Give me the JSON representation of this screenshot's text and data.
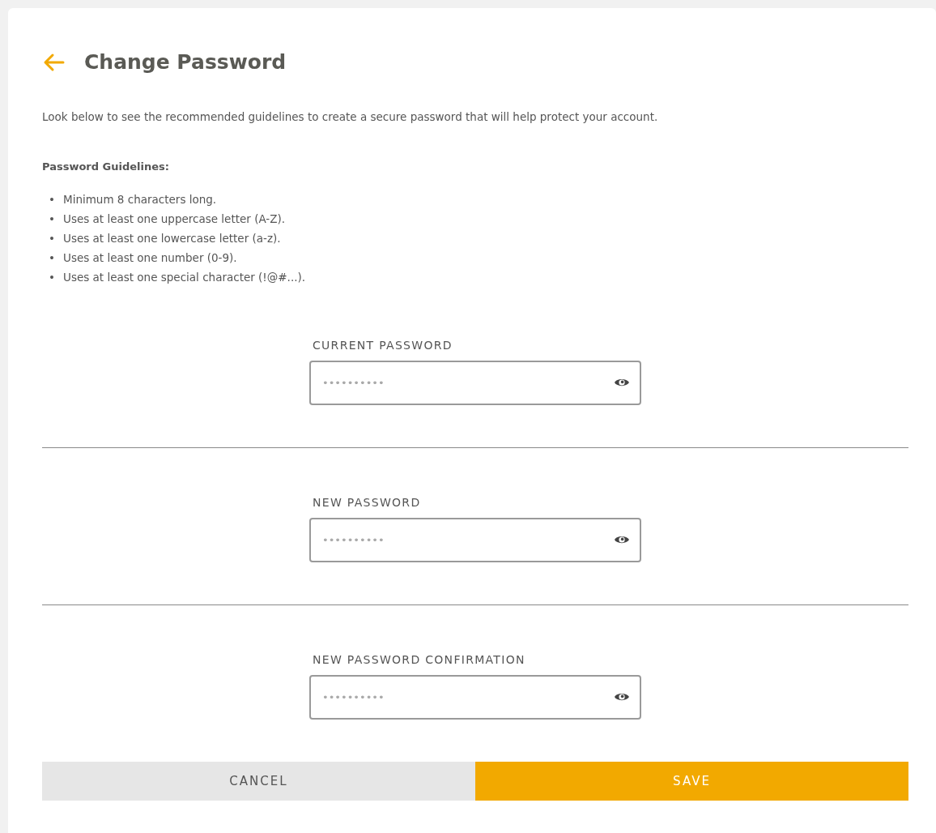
{
  "header": {
    "title": "Change Password"
  },
  "intro": "Look below to see the recommended guidelines to create a secure password that will help protect your account.",
  "guidelines": {
    "heading": "Password Guidelines:",
    "items": [
      {
        "marker": "•",
        "text": "Minimum 8 characters long."
      },
      {
        "marker": "•",
        "text": "Uses at least one uppercase letter (A-Z)."
      },
      {
        "marker": "•",
        "text": "Uses at least one lowercase letter (a-z)."
      },
      {
        "marker": "•",
        "text": "Uses at least one number (0-9)."
      },
      {
        "marker": "•",
        "text": "Uses at least one special character (!@#...)."
      }
    ]
  },
  "fields": [
    {
      "label": "CURRENT PASSWORD",
      "placeholder": "••••••••••"
    },
    {
      "label": "NEW PASSWORD",
      "placeholder": "••••••••••"
    },
    {
      "label": "NEW PASSWORD CONFIRMATION",
      "placeholder": "••••••••••"
    }
  ],
  "buttons": [
    {
      "label": "CANCEL",
      "kind": "secondary"
    },
    {
      "label": "SAVE",
      "kind": "primary"
    }
  ]
}
